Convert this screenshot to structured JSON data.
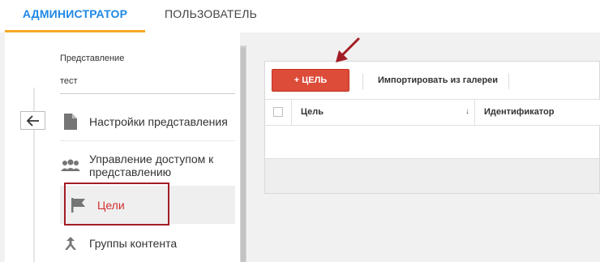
{
  "tabs": {
    "admin": "АДМИНИСТРАТОР",
    "user": "ПОЛЬЗОВАТЕЛЬ"
  },
  "sidebar": {
    "view_label": "Представление",
    "view_value": "тест",
    "items": [
      {
        "label": "Настройки представления",
        "icon": "document-icon"
      },
      {
        "label": "Управление доступом к представлению",
        "icon": "people-icon"
      },
      {
        "label": "Цели",
        "icon": "flag-icon",
        "active": true
      },
      {
        "label": "Группы контента",
        "icon": "content-grouping-icon"
      }
    ]
  },
  "toolbar": {
    "add_goal": "+ ЦЕЛЬ",
    "import_gallery": "Импортировать из галереи"
  },
  "table": {
    "columns": [
      "Цель",
      "Идентификатор"
    ],
    "sort_indicator": "↓"
  },
  "colors": {
    "accent_tab": "#1e88e5",
    "tab_underline": "#f9a825",
    "add_button": "#dd4b39",
    "active_item": "#d32f2f",
    "highlight_box": "#a31d25"
  }
}
